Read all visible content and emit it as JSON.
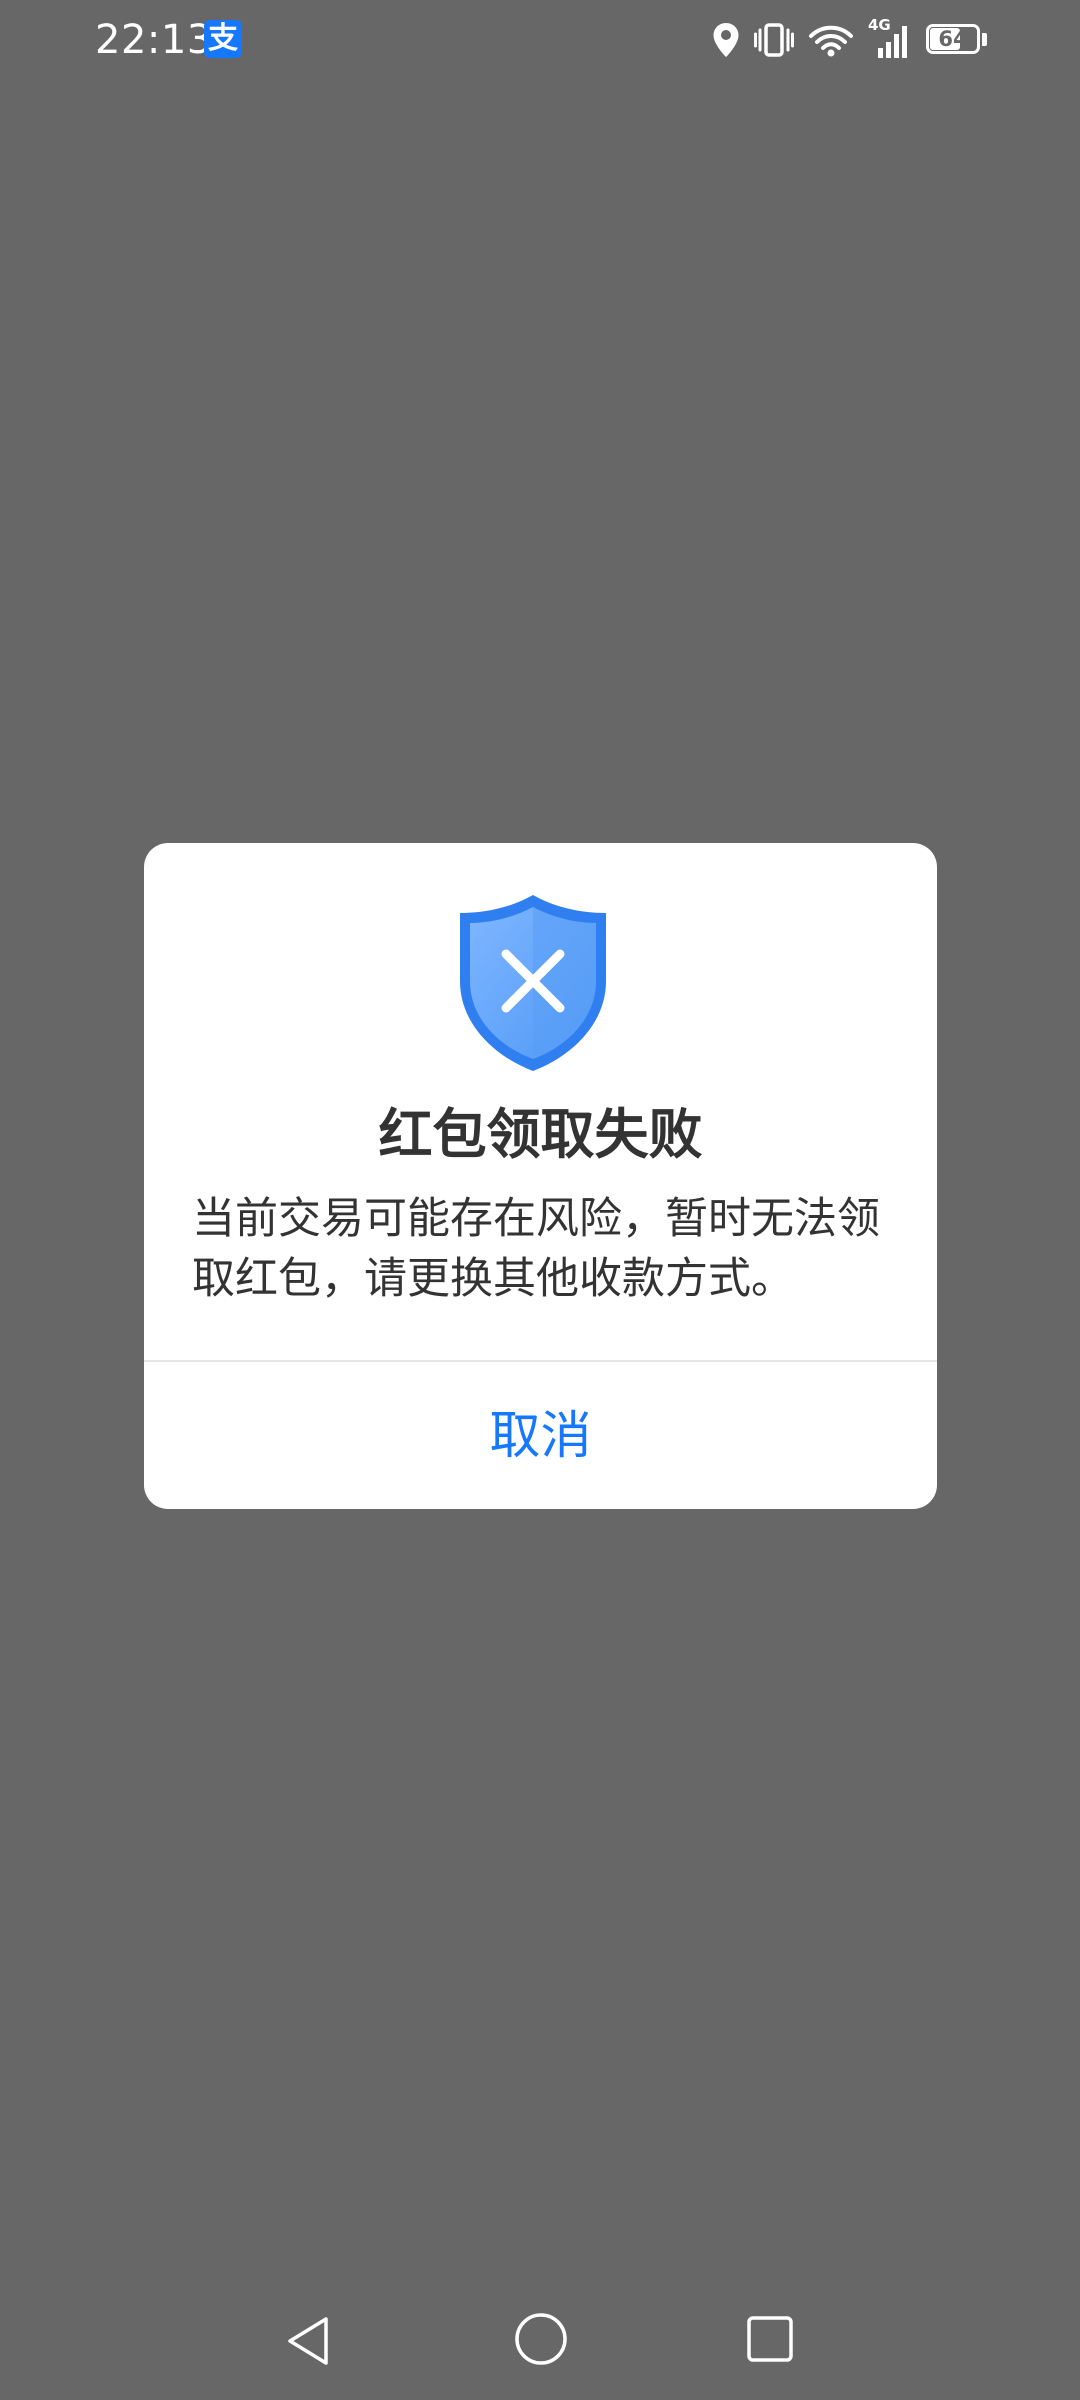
{
  "status_bar": {
    "time": "22:13",
    "app_icon": "alipay-icon",
    "app_icon_glyph": "支",
    "network_label": "4G",
    "battery_level": "64",
    "icons": [
      "location-icon",
      "vibrate-icon",
      "wifi-icon",
      "signal-icon",
      "battery-icon"
    ]
  },
  "dialog": {
    "icon": "shield-x-icon",
    "title": "红包领取失败",
    "message": "当前交易可能存在风险，暂时无法领取红包，请更换其他收款方式。",
    "cancel_label": "取消"
  },
  "nav_bar": {
    "icons": [
      "back-icon",
      "home-icon",
      "recent-apps-icon"
    ]
  },
  "colors": {
    "overlay": "#676767",
    "accent": "#1677ff",
    "title_text": "#333333",
    "shield": "#2f7ff0"
  }
}
